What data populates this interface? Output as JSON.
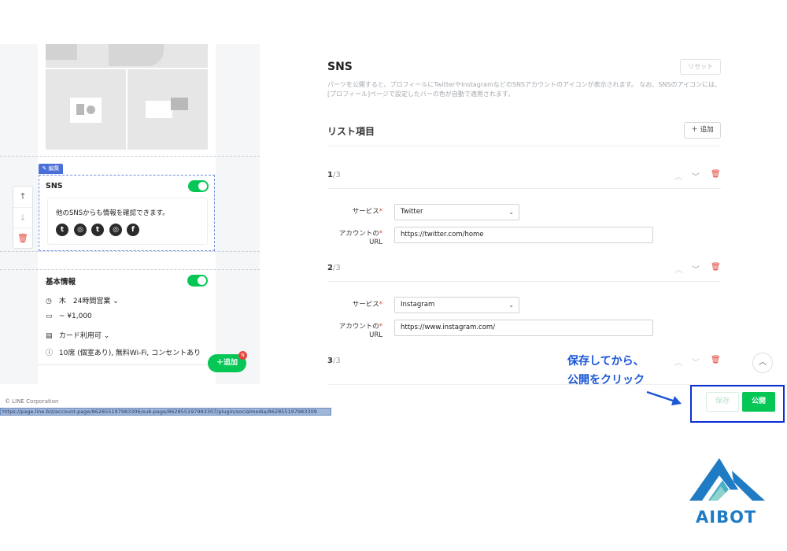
{
  "preview": {
    "edit_tag": "編集",
    "sns_card": {
      "title": "SNS",
      "text": "他のSNSからも情報を確認できます。",
      "icons": [
        "twitter-icon",
        "instagram-icon",
        "twitter-icon",
        "instagram-icon",
        "facebook-icon"
      ]
    },
    "basic_info": {
      "title": "基本情報",
      "rows": [
        {
          "icon": "clock-icon",
          "text": "木　24時間営業 ⌄"
        },
        {
          "icon": "wallet-icon",
          "text": "~ ¥1,000"
        },
        {
          "icon": "card-icon",
          "text": "カード利用可 ⌄"
        },
        {
          "icon": "info-icon",
          "text": "10席 (個室あり), 無料Wi-Fi, コンセントあり"
        }
      ]
    },
    "add_button": "＋追加",
    "badge": "N",
    "copyright": "© LINE Corporation",
    "status_url": "https://page.line.biz/account-page/862855197983306/sub-page/862855197983307/plugin/socialmedia/862855197983309"
  },
  "panel": {
    "title": "SNS",
    "reset_label": "リセット",
    "description": "パーツを公開すると、プロフィールにTwitterやInstagramなどのSNSアカウントのアイコンが表示されます。 なお、SNSのアイコンには、[プロフィール]ページで設定したバーの色が自動で適用されます。",
    "list_title": "リスト項目",
    "add_item_label": "＋ 追加",
    "items": [
      {
        "num": "1",
        "total": "/3",
        "service_label": "サービス",
        "service": "Twitter",
        "url_label": "アカウントの",
        "url_label2": "URL",
        "url": "https://twitter.com/home"
      },
      {
        "num": "2",
        "total": "/3",
        "service_label": "サービス",
        "service": "Instagram",
        "url_label": "アカウントの",
        "url_label2": "URL",
        "url": "https://www.instagram.com/"
      },
      {
        "num": "3",
        "total": "/3"
      }
    ],
    "save_label": "保存",
    "publish_label": "公開"
  },
  "annotation": {
    "line1": "保存してから、",
    "line2": "公開をクリック"
  },
  "logo": {
    "text": "AIBOT"
  },
  "colors": {
    "accent_green": "#06c755",
    "annotation_blue": "#1a56d6",
    "highlight_box": "#0b2fd6",
    "delete_red": "#e2453c"
  }
}
